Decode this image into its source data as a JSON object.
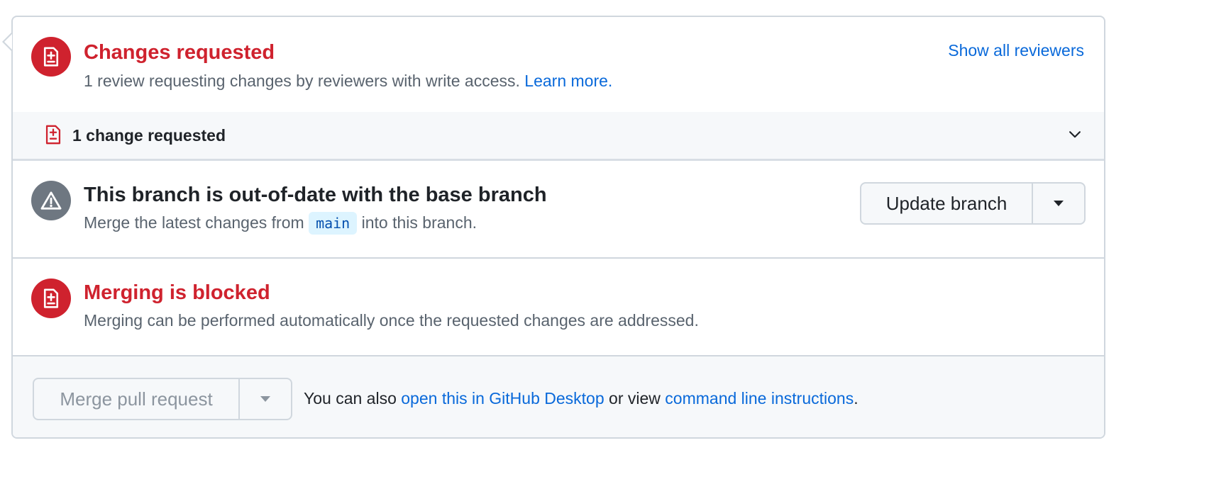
{
  "changes_requested": {
    "title": "Changes requested",
    "description": "1 review requesting changes by reviewers with write access.",
    "learn_more": "Learn more.",
    "show_all_reviewers": "Show all reviewers",
    "summary_label": "1 change requested"
  },
  "branch_status": {
    "title": "This branch is out-of-date with the base branch",
    "description_before": "Merge the latest changes from",
    "branch_name": "main",
    "description_after": "into this branch.",
    "update_button": "Update branch"
  },
  "merge_blocked": {
    "title": "Merging is blocked",
    "description": "Merging can be performed automatically once the requested changes are addressed."
  },
  "merge_footer": {
    "merge_button": "Merge pull request",
    "text_before": "You can also",
    "desktop_link": "open this in GitHub Desktop",
    "text_middle": "or view",
    "cli_link": "command line instructions",
    "text_end": "."
  },
  "colors": {
    "danger": "#cf222e",
    "neutral": "#6e7781",
    "link": "#0969da",
    "border": "#d0d7de",
    "muted_bg": "#f6f8fa"
  },
  "icons": {
    "review_icon": "file-diff-icon",
    "warning_icon": "alert-icon",
    "expand_icon": "chevron-down-icon",
    "dropdown_icon": "triangle-down-icon"
  }
}
